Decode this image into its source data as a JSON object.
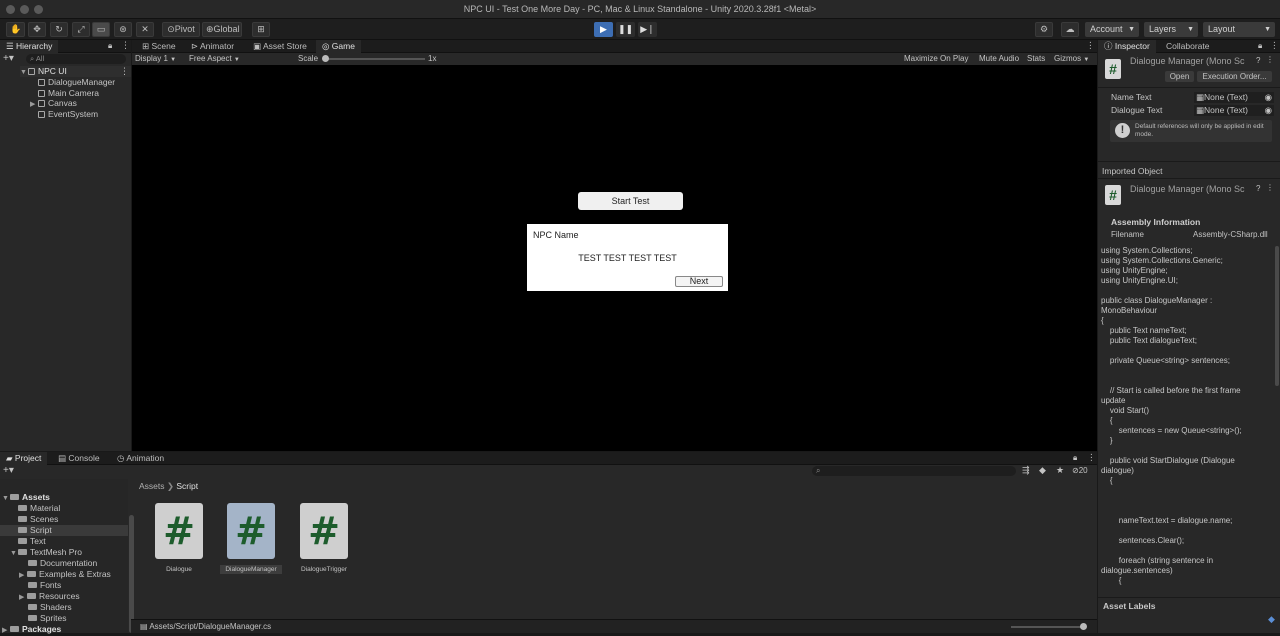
{
  "window": {
    "title": "NPC UI - Test One More Day - PC, Mac & Linux Standalone - Unity 2020.3.28f1 <Metal>"
  },
  "toolbar": {
    "pivot": "Pivot",
    "global": "Global",
    "account": "Account",
    "layers": "Layers",
    "layout": "Layout"
  },
  "hierarchy": {
    "tab": "Hierarchy",
    "search": "All",
    "root": "NPC UI",
    "items": [
      "DialogueManager",
      "Main Camera",
      "Canvas",
      "EventSystem"
    ]
  },
  "viewtabs": {
    "scene": "Scene",
    "animator": "Animator",
    "asset_store": "Asset Store",
    "game": "Game"
  },
  "gamebar": {
    "display": "Display 1",
    "aspect": "Free Aspect",
    "scale_label": "Scale",
    "scale_value": "1x",
    "maximize": "Maximize On Play",
    "mute": "Mute Audio",
    "stats": "Stats",
    "gizmos": "Gizmos"
  },
  "game": {
    "start_button": "Start Test",
    "npc_name": "NPC Name",
    "dialogue": "TEST TEST TEST TEST",
    "next_button": "Next"
  },
  "bottom": {
    "tabs": [
      "Project",
      "Console",
      "Animation"
    ],
    "breadcrumb_root": "Assets",
    "breadcrumb_current": "Script",
    "count": "20",
    "path": "Assets/Script/DialogueManager.cs",
    "tree": [
      {
        "label": "Assets",
        "level": 0
      },
      {
        "label": "Material",
        "level": 1
      },
      {
        "label": "Scenes",
        "level": 1
      },
      {
        "label": "Script",
        "level": 1
      },
      {
        "label": "Text",
        "level": 1
      },
      {
        "label": "TextMesh Pro",
        "level": 1
      },
      {
        "label": "Documentation",
        "level": 2
      },
      {
        "label": "Examples & Extras",
        "level": 2
      },
      {
        "label": "Fonts",
        "level": 2
      },
      {
        "label": "Resources",
        "level": 2
      },
      {
        "label": "Shaders",
        "level": 2
      },
      {
        "label": "Sprites",
        "level": 2
      },
      {
        "label": "Packages",
        "level": 0
      }
    ],
    "assets": [
      "Dialogue",
      "DialogueManager",
      "DialogueTrigger"
    ]
  },
  "inspector": {
    "tab": "Inspector",
    "tab2": "Collaborate",
    "component": "Dialogue Manager (Mono Sc",
    "open": "Open",
    "exec_order": "Execution Order...",
    "name_text_label": "Name Text",
    "name_text_value": "None (Text)",
    "dialogue_text_label": "Dialogue Text",
    "dialogue_text_value": "None (Text)",
    "help": "Default references will only be applied in edit mode.",
    "imported": "Imported Object",
    "component2": "Dialogue Manager (Mono Sc",
    "assembly_info": "Assembly Information",
    "filename_label": "Filename",
    "filename_value": "Assembly-CSharp.dll",
    "code": "using System.Collections;\nusing System.Collections.Generic;\nusing UnityEngine;\nusing UnityEngine.UI;\n\npublic class DialogueManager :\nMonoBehaviour\n{\n    public Text nameText;\n    public Text dialogueText;\n\n    private Queue<string> sentences;\n\n\n    // Start is called before the first frame\nupdate\n    void Start()\n    {\n        sentences = new Queue<string>();\n    }\n\n    public void StartDialogue (Dialogue\ndialogue)\n    {\n\n\n\n        nameText.text = dialogue.name;\n\n        sentences.Clear();\n\n        foreach (string sentence in\ndialogue.sentences)\n        {",
    "asset_labels": "Asset Labels"
  }
}
